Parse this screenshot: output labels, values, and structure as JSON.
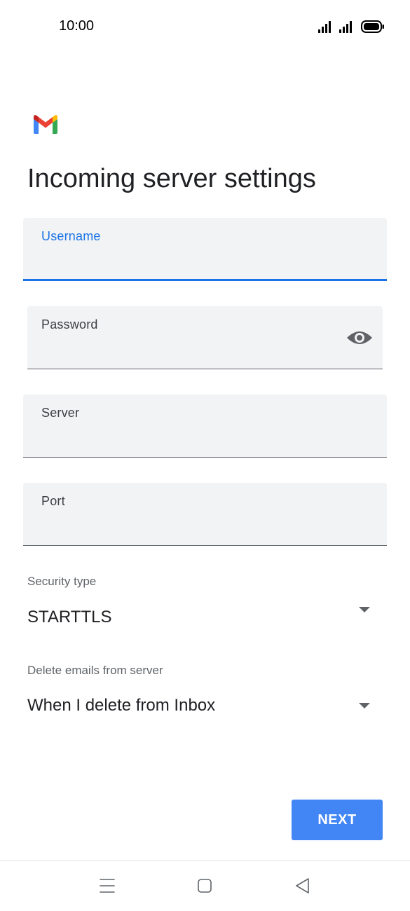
{
  "status_bar": {
    "time": "10:00",
    "icons": [
      "cell-signal-icon",
      "cell-signal-icon",
      "battery-icon"
    ]
  },
  "app": {
    "logo": "gmail-logo-icon",
    "title": "Incoming server settings"
  },
  "form": {
    "username": {
      "label": "Username",
      "value": "",
      "focused": true
    },
    "password": {
      "label": "Password",
      "value": "",
      "toggle_icon": "eye-icon"
    },
    "server": {
      "label": "Server",
      "value": ""
    },
    "port": {
      "label": "Port",
      "value": ""
    },
    "security_type": {
      "label": "Security type",
      "value": "STARTTLS"
    },
    "delete_emails": {
      "label": "Delete emails from server",
      "value": "When I delete from Inbox"
    }
  },
  "actions": {
    "next_label": "NEXT"
  },
  "nav_bar": {
    "icons": [
      "menu-icon",
      "home-icon",
      "back-icon"
    ]
  },
  "colors": {
    "accent": "#1a73e8",
    "button": "#4285f4",
    "field_bg": "#f1f3f4",
    "text": "#202124"
  }
}
